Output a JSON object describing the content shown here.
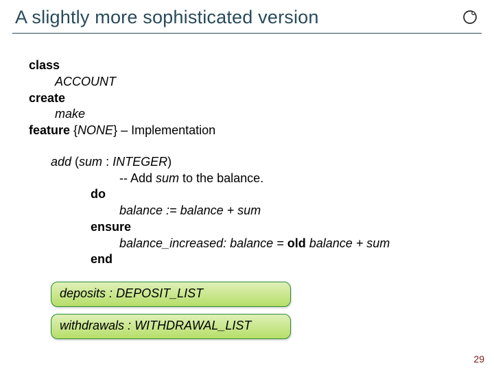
{
  "title": "A slightly more sophisticated version",
  "page_number": 29,
  "logo_name": "ring-logo",
  "code": {
    "kw_class": "class",
    "class_name": "ACCOUNT",
    "kw_create": "create",
    "create_proc": "make",
    "kw_feature": "feature",
    "feature_scope": " {",
    "feature_scope_none": "NONE",
    "feature_scope_close": "}",
    "feature_comment": " – Implementation",
    "routine_name": "add ",
    "routine_sig_open": "(",
    "routine_arg": "sum ",
    "routine_colon": ": ",
    "routine_type": "INTEGER",
    "routine_sig_close": ")",
    "routine_comment": "-- Add ",
    "routine_comment_var": "sum",
    "routine_comment_tail": " to the balance.",
    "kw_do": "do",
    "body_stmt": "balance := balance + sum",
    "kw_ensure": "ensure",
    "post_tag": "balance_increased: ",
    "post_expr_pre": "balance = ",
    "kw_old": "old",
    "post_expr_post": " balance + sum",
    "kw_end": "end",
    "box1_name": "deposits ",
    "box1_colon": ": ",
    "box1_type": "DEPOSIT_LIST",
    "box2_name": "withdrawals ",
    "box2_colon": ": ",
    "box2_type": "WITHDRAWAL_LIST"
  }
}
